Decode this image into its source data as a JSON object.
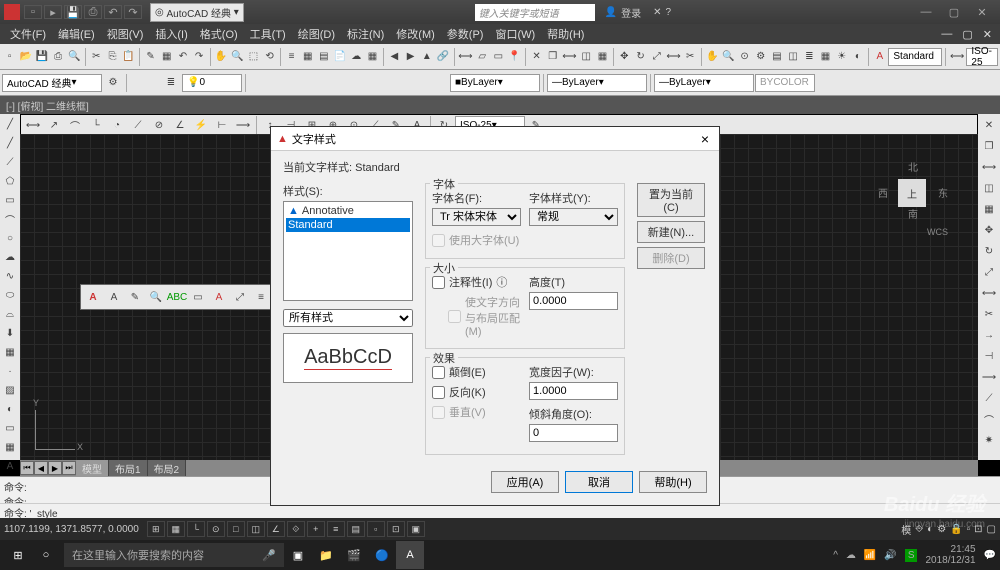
{
  "titlebar": {
    "workspace": "AutoCAD 经典",
    "search_placeholder": "键入关键字或短语",
    "login": "登录"
  },
  "menubar": {
    "items": [
      "文件(F)",
      "编辑(E)",
      "视图(V)",
      "插入(I)",
      "格式(O)",
      "工具(T)",
      "绘图(D)",
      "标注(N)",
      "修改(M)",
      "参数(P)",
      "窗口(W)",
      "帮助(H)"
    ]
  },
  "toolrow1": {
    "workspace_combo": "AutoCAD 经典",
    "layer_combo": "0",
    "style_label": "Standard",
    "iso_label": "ISO-25"
  },
  "toolrow2": {
    "bylayer1": "ByLayer",
    "bylayer2": "ByLayer",
    "bylayer3": "ByLayer",
    "bycolor": "BYCOLOR"
  },
  "document": {
    "title": "[-] [俯视] 二维线框]",
    "dim_combo": "ISO-25"
  },
  "viewcube": {
    "top": "上",
    "n": "北",
    "s": "南",
    "e": "东",
    "w": "西",
    "wcs": "WCS"
  },
  "ucs": {
    "x": "X",
    "y": "Y"
  },
  "tabs": {
    "model": "模型",
    "layout1": "布局1",
    "layout2": "布局2"
  },
  "cmdline": {
    "hist1": "命令:",
    "hist2": "命令:",
    "prompt": "命令: '_style"
  },
  "statusbar": {
    "coords": "1107.1199, 1371.8577, 0.0000",
    "mode1": "模"
  },
  "taskbar": {
    "search_placeholder": "在这里输入你要搜索的内容",
    "time": "21:45",
    "date": "2018/12/31"
  },
  "dialog": {
    "title": "文字样式",
    "current_style_label": "当前文字样式:",
    "current_style_value": "Standard",
    "styles_label": "样式(S):",
    "style_items": [
      "Annotative",
      "Standard"
    ],
    "filter": "所有样式",
    "preview": "AaBbCcD",
    "font_group": "字体",
    "font_name_label": "字体名(F):",
    "font_name_value": "宋体",
    "font_style_label": "字体样式(Y):",
    "font_style_value": "常规",
    "use_bigfont": "使用大字体(U)",
    "size_group": "大小",
    "annotative_cb": "注释性(I)",
    "info_icon": "ⓘ",
    "match_orient": "使文字方向与布局匹配(M)",
    "height_label": "高度(T)",
    "height_value": "0.0000",
    "effects_group": "效果",
    "upside_down": "颠倒(E)",
    "backwards": "反向(K)",
    "vertical": "垂直(V)",
    "width_label": "宽度因子(W):",
    "width_value": "1.0000",
    "oblique_label": "倾斜角度(O):",
    "oblique_value": "0",
    "btn_set_current": "置为当前(C)",
    "btn_new": "新建(N)...",
    "btn_delete": "删除(D)",
    "btn_apply": "应用(A)",
    "btn_cancel": "取消",
    "btn_help": "帮助(H)"
  },
  "watermark": {
    "main": "Baidu 经验",
    "sub": "jingyan.baidu.com"
  }
}
